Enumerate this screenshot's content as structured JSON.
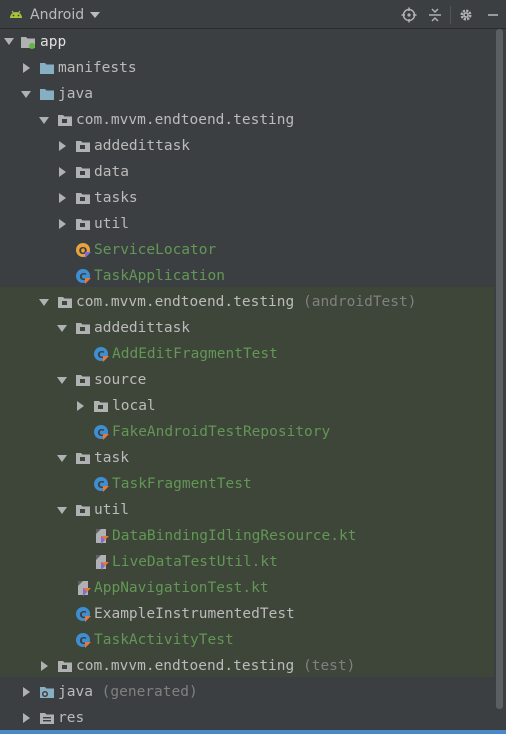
{
  "toolbar": {
    "title": "Android",
    "icons": [
      "android-icon",
      "locate-icon",
      "collapse-icon",
      "gear-icon",
      "minimize-icon"
    ]
  },
  "tree": {
    "app": "app",
    "manifests": "manifests",
    "java": "java",
    "pkg_main": "com.mvvm.endtoend.testing",
    "main_addedittask": "addedittask",
    "main_data": "data",
    "main_tasks": "tasks",
    "main_util": "util",
    "service_locator": "ServiceLocator",
    "task_application": "TaskApplication",
    "pkg_android_test": "com.mvvm.endtoend.testing",
    "pkg_android_test_suffix": "(androidTest)",
    "at_addedittask": "addedittask",
    "add_edit_fragment_test": "AddEditFragmentTest",
    "at_source": "source",
    "at_local": "local",
    "fake_repo": "FakeAndroidTestRepository",
    "at_task": "task",
    "task_fragment_test": "TaskFragmentTest",
    "at_util": "util",
    "data_binding_idling": "DataBindingIdlingResource.kt",
    "live_data_test_util": "LiveDataTestUtil.kt",
    "app_navigation_test": "AppNavigationTest.kt",
    "example_instrumented_test": "ExampleInstrumentedTest",
    "task_activity_test": "TaskActivityTest",
    "pkg_test": "com.mvvm.endtoend.testing",
    "pkg_test_suffix": "(test)",
    "java_generated": "java",
    "java_generated_suffix": "(generated)",
    "res": "res"
  },
  "colors": {
    "background": "#3c3f41",
    "test_background": "#3e4539",
    "text": "#bbbbbb",
    "test_file_text": "#629755",
    "suffix_text": "#808080",
    "folder_blue": "#87afc3",
    "folder_gray": "#afb1b3",
    "accent": "#4a88c7"
  }
}
